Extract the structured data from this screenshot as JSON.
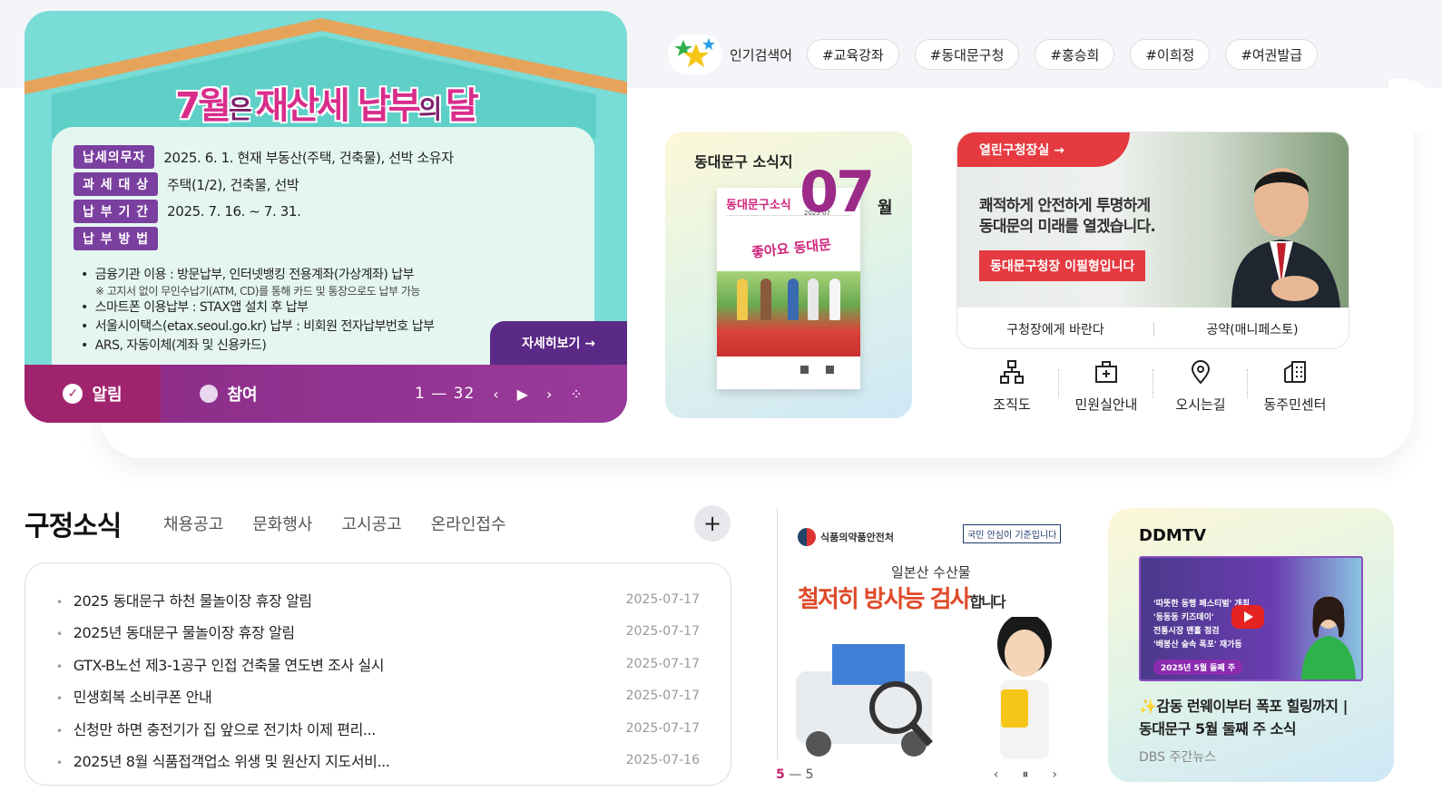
{
  "banner": {
    "title_part1": "7월",
    "title_part2": "은 ",
    "title_part3": "재산세 납부",
    "title_part4": "의 ",
    "title_part5": "달",
    "rows": [
      {
        "tag": "납세의무자",
        "text": "2025. 6. 1. 현재 부동산(주택, 건축물), 선박 소유자"
      },
      {
        "tag": "과 세 대 상",
        "text": "주택(1/2), 건축물, 선박"
      },
      {
        "tag": "납 부 기 간",
        "text": "2025. 7. 16. ~ 7. 31."
      },
      {
        "tag": "납 부 방 법",
        "text": ""
      }
    ],
    "methods": [
      "금융기관 이용 : 방문납부, 인터넷뱅킹 전용계좌(가상계좌) 납부",
      "※ 고지서 없이 무인수납기(ATM, CD)를 통해 카드 및 통장으로도 납부 가능",
      "스마트폰 이용납부 : STAX앱 설치 후 납부",
      "서울시이택스(etax.seoul.go.kr) 납부 : 비회원 전자납부번호 납부",
      "ARS, 자동이체(계좌 및 신용카드)"
    ],
    "more_label": "자세히보기 →",
    "tab_alert": "알림",
    "tab_join": "참여",
    "page_indicator": "1 — 32"
  },
  "popular": {
    "label": "인기검색어",
    "keywords": [
      "#교육강좌",
      "#동대문구청",
      "#홍승희",
      "#이희정",
      "#여권발급"
    ]
  },
  "newsletter": {
    "title": "동대문구 소식지",
    "month_number": "07",
    "month_unit": "월",
    "cover_title": "동대문구소식",
    "cover_date": "2025 07",
    "cover_slogan": "좋아요 동대문"
  },
  "mayor": {
    "header": "열린구청장실 →",
    "slogan_line1": "쾌적하게 안전하게 투명하게",
    "slogan_line2": "동대문의 미래를 열겠습니다.",
    "name_label": "동대문구청장 이필형입니다",
    "link1": "구청장에게 바란다",
    "link2": "공약(매니페스토)"
  },
  "quick_links": [
    "조직도",
    "민원실안내",
    "오시는길",
    "동주민센터"
  ],
  "gu_news": {
    "title": "구정소식",
    "tabs": [
      "채용공고",
      "문화행사",
      "고시공고",
      "온라인접수"
    ],
    "more": "+",
    "items": [
      {
        "title": "2025 동대문구 하천 물놀이장 휴장 알림",
        "date": "2025-07-17"
      },
      {
        "title": "2025년 동대문구 물놀이장 휴장 알림",
        "date": "2025-07-17"
      },
      {
        "title": "GTX-B노선 제3-1공구 인접 건축물 연도변 조사 실시",
        "date": "2025-07-17"
      },
      {
        "title": "민생회복 소비쿠폰 안내",
        "date": "2025-07-17"
      },
      {
        "title": "신청만 하면 충전기가 집 앞으로 전기차 이제 편리...",
        "date": "2025-07-17"
      },
      {
        "title": "2025년 8월 식품접객업소 위생 및 원산지 지도서비...",
        "date": "2025-07-16"
      }
    ]
  },
  "promo": {
    "org": "식품의약품안전처",
    "org_slogan": "국민 안심이 기준입니다",
    "subtitle": "일본산 수산물",
    "headline": "철저히 방사능 검사",
    "headline_suffix": "합니다",
    "page_current": "5",
    "page_sep": " — ",
    "page_total": "5"
  },
  "ddmtv": {
    "title": "DDMTV",
    "bullets": [
      "'따뜻한 동행 페스티벌' 개최",
      "'동동동 키즈데이'",
      "전통시장 맨홀 점검",
      "'배봉산 숲속 폭포' 재가동"
    ],
    "badge": "2025년 5월 둘째 주",
    "caption_line1": "✨감동 런웨이부터 폭포 힐링까지 |",
    "caption_line2": "동대문구 5월 둘째 주 소식",
    "source": "DBS 주간뉴스"
  },
  "colors": {
    "brand_purple": "#7b3fa0",
    "accent_magenta": "#a0246d",
    "mayor_red": "#e53a40",
    "mint": "#79dcd6"
  }
}
